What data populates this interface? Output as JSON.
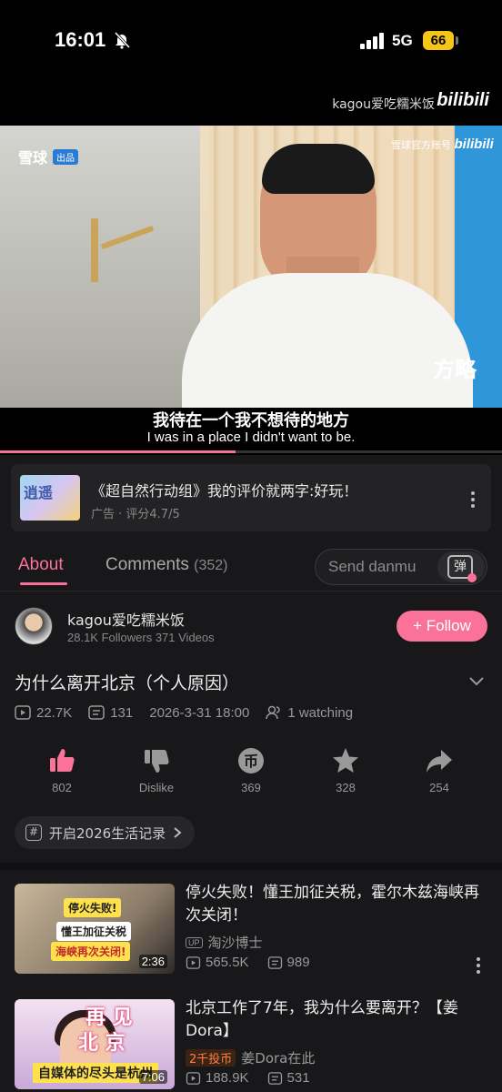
{
  "status_bar": {
    "time": "16:01",
    "network": "5G",
    "battery": "66"
  },
  "video": {
    "watermark_user": "kagou爱吃糯米饭",
    "watermark_logo": "bilibili",
    "logo_left": "雪球",
    "logo_left_tag": "出品",
    "logo_right_label": "雪球官方账号",
    "logo_right_brand": "bilibili",
    "corner_text": "方略",
    "subtitle_zh": "我待在一个我不想待的地方",
    "subtitle_en": "I was in a place I didn't want to be.",
    "progress": 0.47
  },
  "ad": {
    "thumb_text": "逍遥",
    "title": "《超自然行动组》我的评价就两字:好玩！",
    "meta": "广告 · 评分4.7/5"
  },
  "tabs": {
    "about": "About",
    "comments": "Comments",
    "comments_count": "(352)",
    "danmu_placeholder": "Send danmu",
    "danmu_icon": "弹"
  },
  "uploader": {
    "name": "kagou爱吃糯米饭",
    "stats": "28.1K Followers  371 Videos",
    "follow_label": "+ Follow"
  },
  "video_info": {
    "title": "为什么离开北京（个人原因）",
    "views": "22.7K",
    "danmaku": "131",
    "date": "2026-3-31 18:00",
    "watching": "1 watching"
  },
  "actions": {
    "like": "802",
    "dislike": "Dislike",
    "coin": "369",
    "favorite": "328",
    "share": "254",
    "coin_glyph": "币"
  },
  "topic": {
    "label": "开启2026生活记录",
    "hash": "#"
  },
  "recommendations": [
    {
      "title": "停火失败！懂王加征关税，霍尔木兹海峡再次关闭！",
      "author": "淘沙博士",
      "up_tag": "UP",
      "views": "565.5K",
      "danmaku": "989",
      "duration": "2:36",
      "thumb_tags": [
        "停火失败!",
        "懂王加征关税",
        "海峡再次关闭!"
      ]
    },
    {
      "title": "北京工作了7年，我为什么要离开？【姜Dora】",
      "badge": "2千投币",
      "author": "姜Dora在此",
      "views": "188.9K",
      "danmaku": "531",
      "duration": "7:06",
      "thumb_big_1": "再 见",
      "thumb_big_2": "北 京",
      "thumb_strip": "自媒体的尽头是杭州"
    }
  ],
  "colors": {
    "accent": "#fb7299",
    "background": "#18181a",
    "muted": "#999999"
  },
  "icons": [
    "bell-slash-icon",
    "signal-icon",
    "more-vertical-icon",
    "chevron-down-icon",
    "play-count-icon",
    "danmaku-count-icon",
    "watching-icon",
    "like-icon",
    "dislike-icon",
    "coin-icon",
    "favorite-icon",
    "share-icon",
    "hashtag-icon"
  ]
}
